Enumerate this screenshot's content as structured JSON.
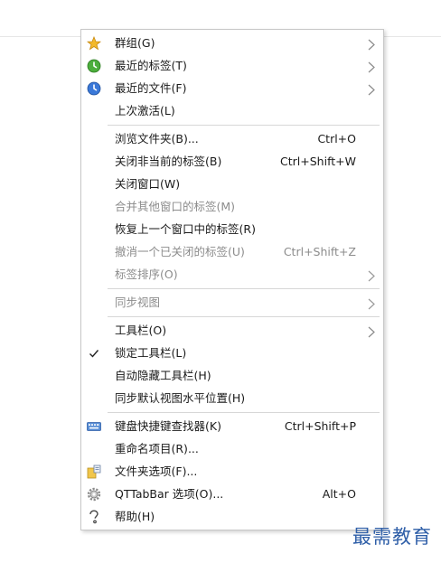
{
  "menu": {
    "items": [
      {
        "label": "群组(G)",
        "icon": "star-icon",
        "submenu": true
      },
      {
        "label": "最近的标签(T)",
        "icon": "recent-tabs-icon",
        "submenu": true
      },
      {
        "label": "最近的文件(F)",
        "icon": "recent-files-icon",
        "submenu": true
      },
      {
        "label": "上次激活(L)"
      },
      {
        "label": "浏览文件夹(B)...",
        "shortcut": "Ctrl+O"
      },
      {
        "label": "关闭非当前的标签(B)",
        "shortcut": "Ctrl+Shift+W"
      },
      {
        "label": "关闭窗口(W)"
      },
      {
        "label": "合并其他窗口的标签(M)",
        "disabled": true
      },
      {
        "label": "恢复上一个窗口中的标签(R)"
      },
      {
        "label": "撤消一个已关闭的标签(U)",
        "shortcut": "Ctrl+Shift+Z",
        "disabled": true
      },
      {
        "label": "标签排序(O)",
        "disabled": true,
        "submenu": true
      },
      {
        "label": "同步视图",
        "disabled": true,
        "submenu": true
      },
      {
        "label": "工具栏(O)",
        "submenu": true
      },
      {
        "label": "锁定工具栏(L)",
        "checked": true
      },
      {
        "label": "自动隐藏工具栏(H)"
      },
      {
        "label": "同步默认视图水平位置(H)"
      },
      {
        "label": "键盘快捷键查找器(K)",
        "shortcut": "Ctrl+Shift+P",
        "icon": "keyboard-icon"
      },
      {
        "label": "重命名项目(R)..."
      },
      {
        "label": "文件夹选项(F)...",
        "icon": "folder-options-icon"
      },
      {
        "label": "QTTabBar 选项(O)...",
        "shortcut": "Alt+O",
        "icon": "settings-gear-icon"
      },
      {
        "label": "帮助(H)",
        "icon": "help-icon"
      }
    ]
  },
  "watermark": "最需教育",
  "colors": {
    "text": "#1a1a1a",
    "disabled_text": "#8c8c8c",
    "separator": "#d7d7d7",
    "watermark": "#2f5fa8"
  }
}
